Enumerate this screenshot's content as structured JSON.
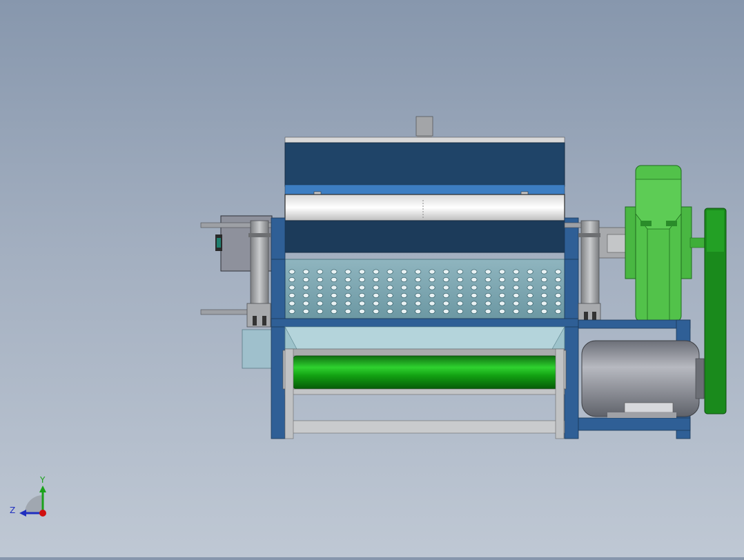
{
  "viewport": {
    "background_top": "#8797ad",
    "background_bottom": "#bfc8d4"
  },
  "model": {
    "colors": {
      "frame_blue": "#2f5f96",
      "hood_dark": "#1f4468",
      "hood_mid": "#3d7ec2",
      "green": "#3fb23a",
      "dark_green": "#1a8a1c",
      "motor_gray": "#8e919a",
      "steel": "#b0b2b4"
    }
  },
  "triad": {
    "y_label": "Y",
    "z_label": "Z",
    "y_color": "#1ba21b",
    "z_color": "#1f2ebf",
    "origin_color": "#d01010"
  }
}
